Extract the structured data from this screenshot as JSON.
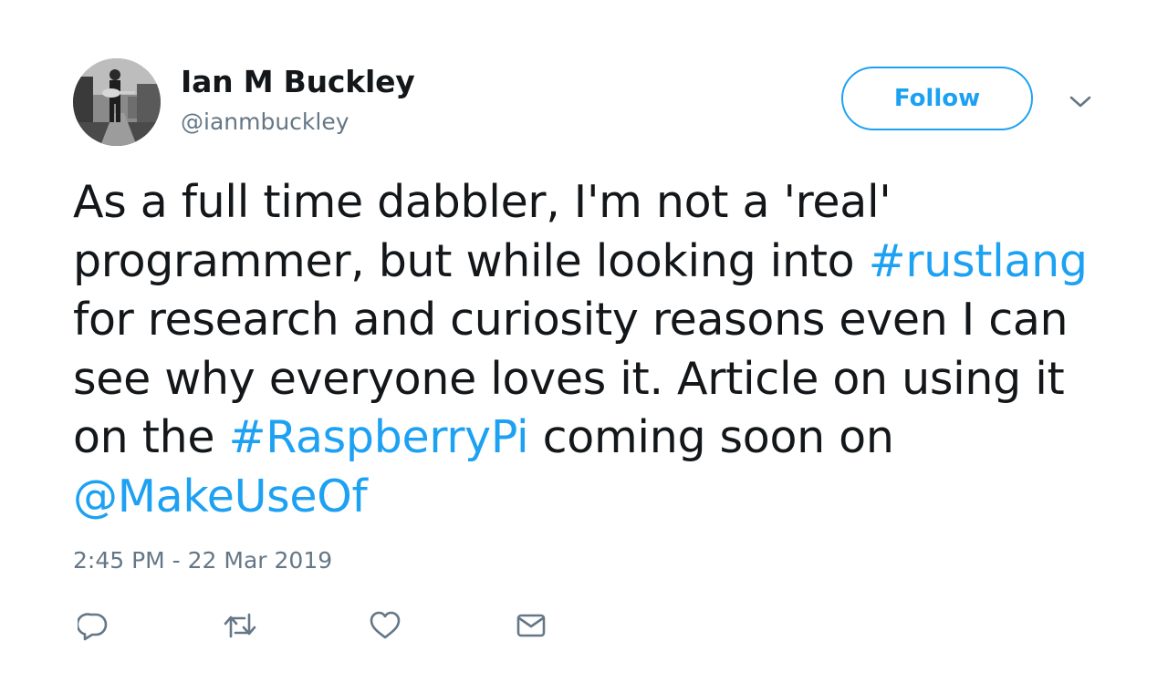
{
  "user": {
    "display_name": "Ian M Buckley",
    "screen_name": "@ianmbuckley",
    "avatar_icon": "profile-photo"
  },
  "follow_button": {
    "label": "Follow"
  },
  "menu": {
    "icon": "chevron-down-icon"
  },
  "tweet": {
    "lines": [
      {
        "segments": [
          {
            "text": "As a full time dabbler, I'm not a 'real'"
          }
        ]
      },
      {
        "segments": [
          {
            "text": "programmer, but while looking into "
          },
          {
            "text": "#rustlang",
            "link": true
          }
        ]
      },
      {
        "segments": [
          {
            "text": "for research and curiosity reasons even I can"
          }
        ]
      },
      {
        "segments": [
          {
            "text": "see why everyone loves it. Article on using it"
          }
        ]
      },
      {
        "segments": [
          {
            "text": "on the "
          },
          {
            "text": "#RaspberryPi",
            "link": true
          },
          {
            "text": " coming soon on"
          }
        ]
      },
      {
        "segments": [
          {
            "text": "@MakeUseOf",
            "link": true
          }
        ]
      }
    ],
    "timestamp": "2:45 PM - 22 Mar 2019"
  },
  "actions": [
    {
      "name": "reply",
      "icon": "reply-icon"
    },
    {
      "name": "retweet",
      "icon": "retweet-icon"
    },
    {
      "name": "like",
      "icon": "heart-icon"
    },
    {
      "name": "direct-message",
      "icon": "envelope-icon"
    }
  ],
  "colors": {
    "accent": "#1da1f2",
    "text": "#14171a",
    "secondary": "#657786"
  }
}
